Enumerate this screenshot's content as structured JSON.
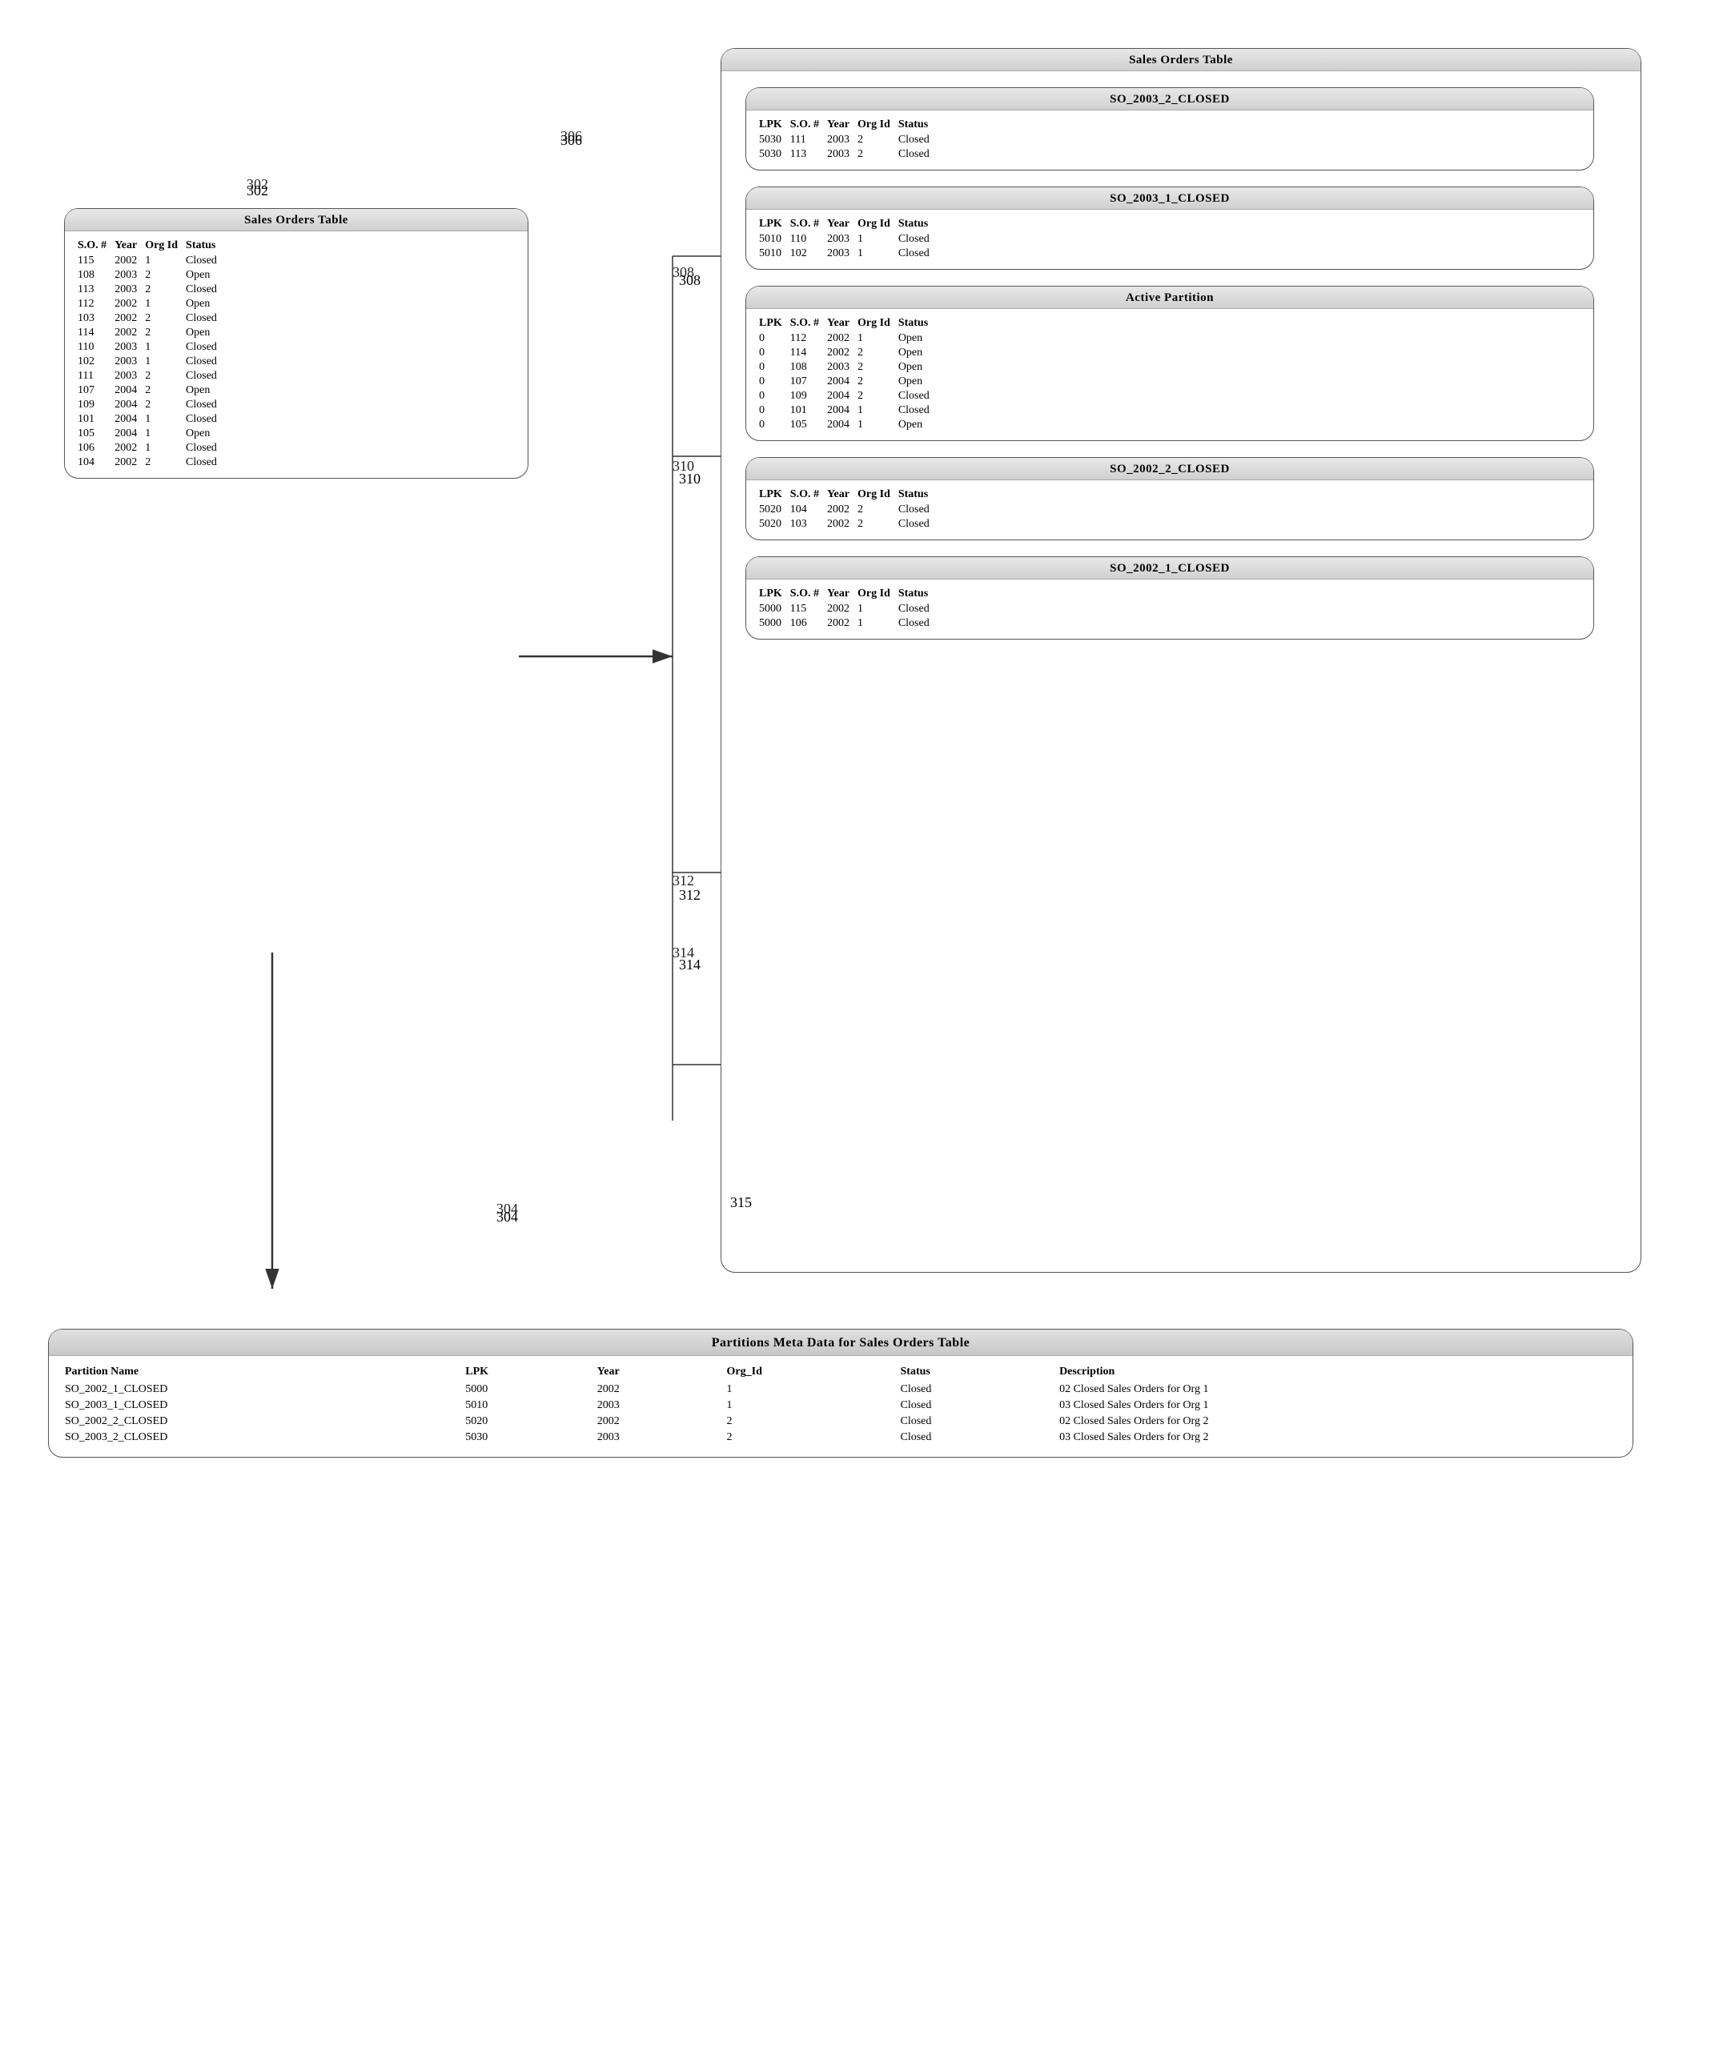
{
  "diagram": {
    "labels": {
      "302": "302",
      "304": "304",
      "306": "306",
      "308": "308",
      "310": "310",
      "312": "312",
      "314": "314",
      "315": "315"
    },
    "sales_orders_table_left": {
      "title": "Sales Orders Table",
      "columns": [
        "S.O. #",
        "Year",
        "Org Id",
        "Status"
      ],
      "rows": [
        [
          "115",
          "2002",
          "1",
          "Closed"
        ],
        [
          "108",
          "2003",
          "2",
          "Open"
        ],
        [
          "113",
          "2003",
          "2",
          "Closed"
        ],
        [
          "112",
          "2002",
          "1",
          "Open"
        ],
        [
          "103",
          "2002",
          "2",
          "Closed"
        ],
        [
          "114",
          "2002",
          "2",
          "Open"
        ],
        [
          "110",
          "2003",
          "1",
          "Closed"
        ],
        [
          "102",
          "2003",
          "1",
          "Closed"
        ],
        [
          "111",
          "2003",
          "2",
          "Closed"
        ],
        [
          "107",
          "2004",
          "2",
          "Open"
        ],
        [
          "109",
          "2004",
          "2",
          "Closed"
        ],
        [
          "101",
          "2004",
          "1",
          "Closed"
        ],
        [
          "105",
          "2004",
          "1",
          "Open"
        ],
        [
          "106",
          "2002",
          "1",
          "Closed"
        ],
        [
          "104",
          "2002",
          "2",
          "Closed"
        ]
      ]
    },
    "so_2003_2_closed": {
      "title": "SO_2003_2_CLOSED",
      "columns": [
        "LPK",
        "S.O. #",
        "Year",
        "Org Id",
        "Status"
      ],
      "rows": [
        [
          "5030",
          "111",
          "2003",
          "2",
          "Closed"
        ],
        [
          "5030",
          "113",
          "2003",
          "2",
          "Closed"
        ]
      ]
    },
    "so_2003_1_closed": {
      "title": "SO_2003_1_CLOSED",
      "columns": [
        "LPK",
        "S.O. #",
        "Year",
        "Org Id",
        "Status"
      ],
      "rows": [
        [
          "5010",
          "110",
          "2003",
          "1",
          "Closed"
        ],
        [
          "5010",
          "102",
          "2003",
          "1",
          "Closed"
        ]
      ]
    },
    "active_partition": {
      "title": "Active Partition",
      "columns": [
        "LPK",
        "S.O. #",
        "Year",
        "Org Id",
        "Status"
      ],
      "rows": [
        [
          "0",
          "112",
          "2002",
          "1",
          "Open"
        ],
        [
          "0",
          "114",
          "2002",
          "2",
          "Open"
        ],
        [
          "0",
          "108",
          "2003",
          "2",
          "Open"
        ],
        [
          "0",
          "107",
          "2004",
          "2",
          "Open"
        ],
        [
          "0",
          "109",
          "2004",
          "2",
          "Closed"
        ],
        [
          "0",
          "101",
          "2004",
          "1",
          "Closed"
        ],
        [
          "0",
          "105",
          "2004",
          "1",
          "Open"
        ]
      ]
    },
    "so_2002_2_closed": {
      "title": "SO_2002_2_CLOSED",
      "columns": [
        "LPK",
        "S.O. #",
        "Year",
        "Org Id",
        "Status"
      ],
      "rows": [
        [
          "5020",
          "104",
          "2002",
          "2",
          "Closed"
        ],
        [
          "5020",
          "103",
          "2002",
          "2",
          "Closed"
        ]
      ]
    },
    "so_2002_1_closed": {
      "title": "SO_2002_1_CLOSED",
      "columns": [
        "LPK",
        "S.O. #",
        "Year",
        "Org Id",
        "Status"
      ],
      "rows": [
        [
          "5000",
          "115",
          "2002",
          "1",
          "Closed"
        ],
        [
          "5000",
          "106",
          "2002",
          "1",
          "Closed"
        ]
      ]
    },
    "meta_table": {
      "title": "Partitions Meta Data for Sales Orders Table",
      "columns": [
        "Partition Name",
        "LPK",
        "Year",
        "Org_Id",
        "Status",
        "Description"
      ],
      "rows": [
        [
          "SO_2002_1_CLOSED",
          "5000",
          "2002",
          "1",
          "Closed",
          "02 Closed Sales Orders for Org 1"
        ],
        [
          "SO_2003_1_CLOSED",
          "5010",
          "2003",
          "1",
          "Closed",
          "03 Closed Sales Orders for Org 1"
        ],
        [
          "SO_2002_2_CLOSED",
          "5020",
          "2002",
          "2",
          "Closed",
          "02 Closed Sales Orders for Org 2"
        ],
        [
          "SO_2003_2_CLOSED",
          "5030",
          "2003",
          "2",
          "Closed",
          "03 Closed Sales Orders for Org 2"
        ]
      ]
    }
  }
}
